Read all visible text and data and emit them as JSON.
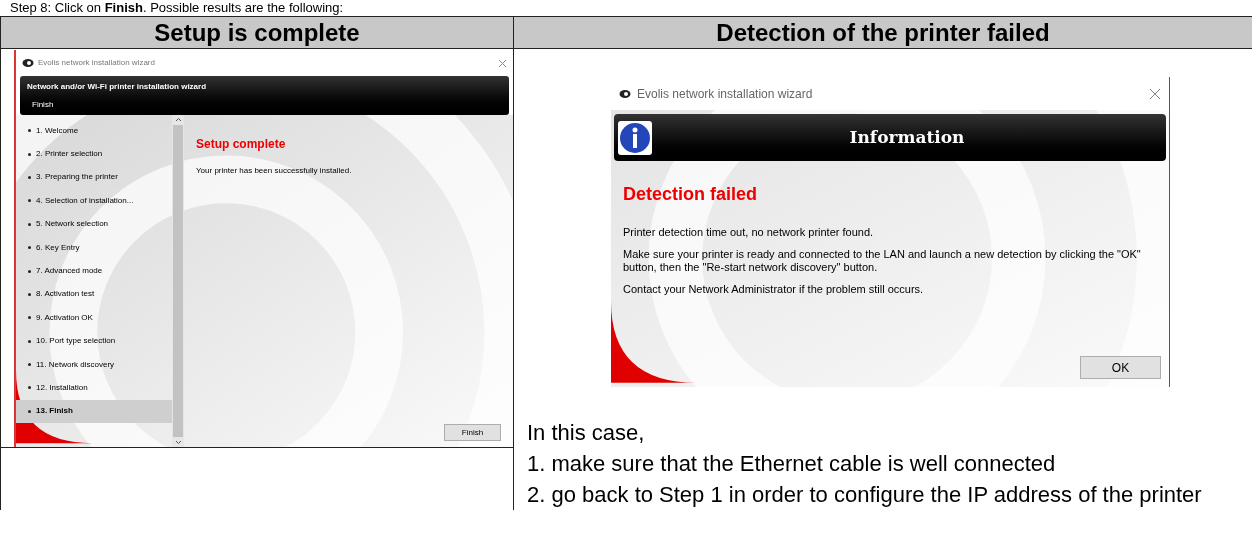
{
  "heading": "Step 8: Click on **Finish**. Possible results are the following:",
  "columns": [
    "Setup is complete",
    "Detection of the printer failed"
  ],
  "wizard": {
    "title": "Evolis network installation wizard",
    "banner_title": "Network and/or Wi-Fi printer installation wizard",
    "banner_subtitle": "Finish",
    "steps": [
      {
        "label": "1. Welcome",
        "selected": false
      },
      {
        "label": "2. Printer selection",
        "selected": false
      },
      {
        "label": "3. Preparing the printer",
        "selected": false
      },
      {
        "label": "4. Selection of installation...",
        "selected": false
      },
      {
        "label": "5. Network selection",
        "selected": false
      },
      {
        "label": "6. Key Entry",
        "selected": false
      },
      {
        "label": "7. Advanced mode",
        "selected": false
      },
      {
        "label": "8. Activation test",
        "selected": false
      },
      {
        "label": "9. Activation OK",
        "selected": false
      },
      {
        "label": "10. Port type selection",
        "selected": false
      },
      {
        "label": "11. Network discovery",
        "selected": false
      },
      {
        "label": "12. Installation",
        "selected": false
      },
      {
        "label": "13. Finish",
        "selected": true
      }
    ],
    "heading": "Setup complete",
    "message": "Your printer has been successfully installed.",
    "button": "Finish"
  },
  "dialog": {
    "title": "Evolis network installation wizard",
    "banner_title": "Information",
    "heading": "Detection failed",
    "paragraphs": [
      "Printer detection time out, no network printer found.",
      "Make sure your printer is ready and connected to the LAN and launch a new detection by clicking the \"OK\" button, then the \"Re-start network discovery\" button.",
      "Contact your Network Administrator if the problem still occurs."
    ],
    "button": "OK"
  },
  "notes": [
    "In this case,",
    "1. make sure that the Ethernet cable is well connected",
    "2. go back to Step 1 in order to configure the IP address of the printer"
  ]
}
